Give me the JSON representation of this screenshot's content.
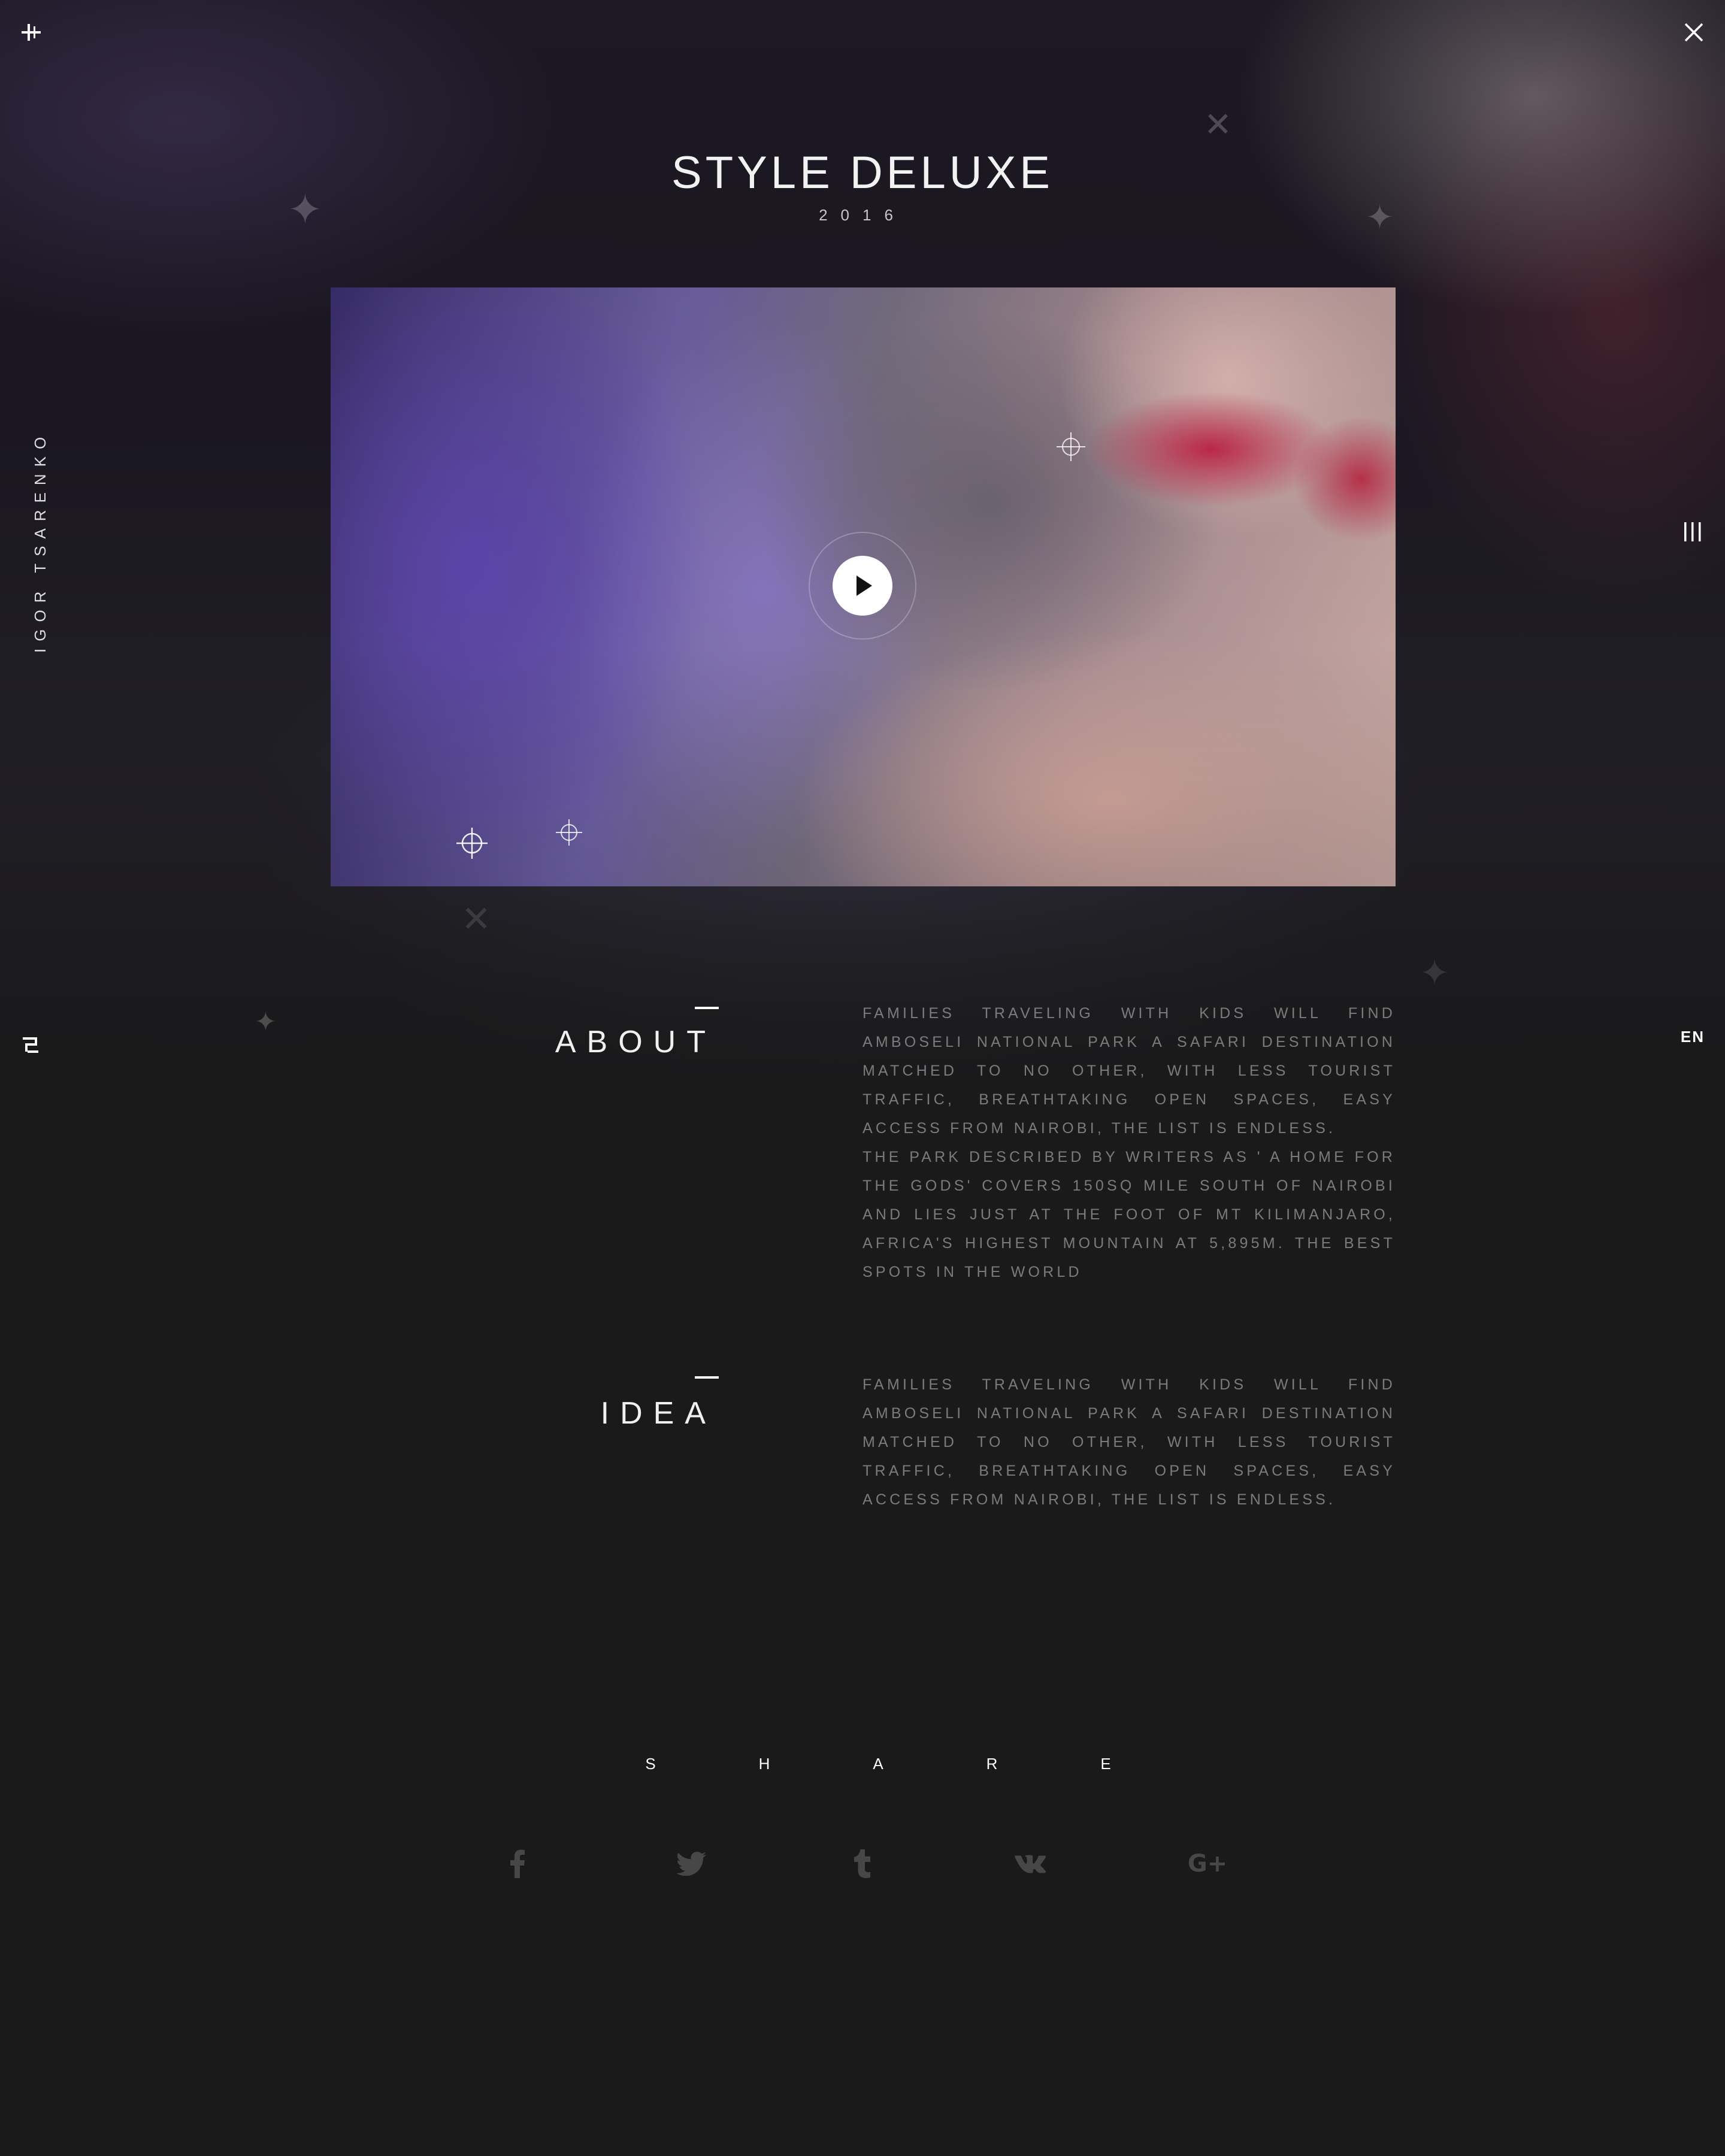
{
  "header": {
    "title": "STYLE DELUXE",
    "year": "2016"
  },
  "author": "IGOR TSARENKO",
  "language": "EN",
  "icons": {
    "top_left": "plus-icon",
    "top_right": "close-icon",
    "right_middle": "menu-icon",
    "left_logo": "brand-logo-icon",
    "video": [
      "play-icon",
      "crosshair-icon",
      "crosshair-icon",
      "crosshair-icon"
    ]
  },
  "sections": [
    {
      "title": "ABOUT",
      "paragraphs": [
        "Families traveling with kids will find Amboseli national park a safari destination matched to no other, with less tourist traffic, breathtaking open spaces, easy access from Nairobi, the list is endless.",
        "The park described by writers as ' a home for the Gods' covers 150sq mile south of Nairobi and lies just at the foot of Mt Kilimanjaro, Africa's highest mountain at 5,895m. The best spots in the world"
      ]
    },
    {
      "title": "IDEA",
      "paragraphs": [
        "Families traveling with kids will find Amboseli national park a safari destination matched to no other, with less tourist traffic, breathtaking open spaces, easy access from Nairobi, the list is endless."
      ]
    }
  ],
  "share": {
    "letters": [
      "S",
      "H",
      "A",
      "R",
      "E"
    ],
    "networks": [
      "facebook-icon",
      "twitter-icon",
      "tumblr-icon",
      "vk-icon",
      "google-plus-icon"
    ],
    "google_plus_label": "G+"
  },
  "colors": {
    "background": "#1a1a1b",
    "text": "#ffffff",
    "muted_text": "#6e6e6f",
    "social_icon": "#3a3a3b"
  }
}
